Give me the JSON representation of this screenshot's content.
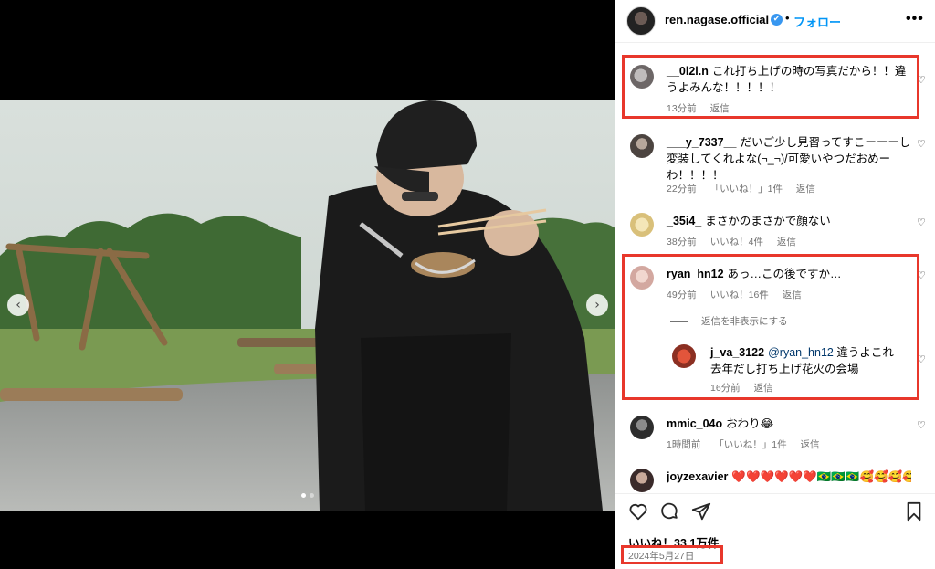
{
  "post": {
    "author": "ren.nagase.official",
    "verified_mark": "✔",
    "separator": "•",
    "follow_label": "フォロー",
    "more_label": "•••",
    "likes_label": "いいね！33.1万件",
    "date": "2024年5月27日"
  },
  "media": {
    "prev_arrow": "‹",
    "next_arrow": "›",
    "page_count": 2,
    "current_page": 1
  },
  "comments": [
    {
      "user": "__0l2l.n",
      "text": "これ打ち上げの時の写真だから！！違うよみんな！！！！！",
      "time": "13分前",
      "likes": "",
      "reply": "返信",
      "highlighted": true
    },
    {
      "user": "___y_7337__",
      "text": "だいご少し見習ってすこーーーし変装してくれよな(¬_¬)/可愛いやつだおめーわ！！！！",
      "time": "22分前",
      "likes": "「いいね！」1件",
      "reply": "返信",
      "highlighted": false
    },
    {
      "user": "_35i4_",
      "text": "まさかのまさかで顔ない",
      "time": "38分前",
      "likes": "いいね！4件",
      "reply": "返信",
      "highlighted": false
    },
    {
      "user": "ryan_hn12",
      "text": "あっ…この後ですか…",
      "time": "49分前",
      "likes": "いいね！16件",
      "reply": "返信",
      "highlighted": true,
      "hide_replies_label": "返信を非表示にする",
      "replies": [
        {
          "user": "j_va_3122",
          "mention": "@ryan_hn12",
          "text": "違うよこれ去年だし打ち上げ花火の会場",
          "time": "16分前",
          "reply": "返信"
        }
      ]
    },
    {
      "user": "mmic_04o",
      "text": "おわり😂",
      "time": "1時間前",
      "likes": "「いいね！」1件",
      "reply": "返信",
      "highlighted": false
    },
    {
      "user": "joyzexavier",
      "text": "❤️❤️❤️❤️❤️❤️🇧🇷🇧🇷🇧🇷🥰🥰🥰🥰🥰",
      "highlighted": false
    }
  ],
  "heart_glyph": "♡",
  "colors": {
    "accent": "#0095f6",
    "highlight_box": "#e8372b",
    "meta_gray": "#737373"
  }
}
